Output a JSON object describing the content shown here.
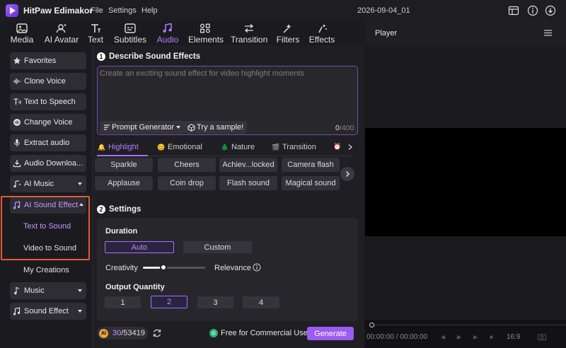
{
  "app": {
    "name": "HitPaw Edimakor",
    "menus": [
      "File",
      "Settings",
      "Help"
    ],
    "project": "2026-09-04_01"
  },
  "tabs": [
    {
      "label": "Media",
      "icon": "media-icon"
    },
    {
      "label": "AI Avatar",
      "icon": "ai-avatar-icon"
    },
    {
      "label": "Text",
      "icon": "text-icon"
    },
    {
      "label": "Subtitles",
      "icon": "subtitles-icon"
    },
    {
      "label": "Audio",
      "icon": "audio-icon",
      "active": true
    },
    {
      "label": "Elements",
      "icon": "elements-icon"
    },
    {
      "label": "Transition",
      "icon": "transition-icon"
    },
    {
      "label": "Filters",
      "icon": "filters-icon"
    },
    {
      "label": "Effects",
      "icon": "effects-icon"
    }
  ],
  "sidebar": {
    "items": [
      {
        "label": "Favorites",
        "icon": "star-icon"
      },
      {
        "label": "Clone Voice",
        "icon": "wave-icon"
      },
      {
        "label": "Text to Speech",
        "icon": "tts-icon"
      },
      {
        "label": "Change Voice",
        "icon": "voice-icon"
      },
      {
        "label": "Extract audio",
        "icon": "mic-icon"
      },
      {
        "label": "Audio Downloa...",
        "icon": "download-icon"
      },
      {
        "label": "AI Music",
        "icon": "ai-music-icon"
      },
      {
        "label": "AI Sound Effect",
        "icon": "ai-sound-icon",
        "active": true
      },
      {
        "label": "Music",
        "icon": "music-icon"
      },
      {
        "label": "Sound Effect",
        "icon": "sound-effect-icon"
      }
    ],
    "sub": [
      "Text to Sound",
      "Video to Sound"
    ],
    "my_creations": "My Creations"
  },
  "describe": {
    "number": "1",
    "title": "Describe Sound Effects",
    "placeholder": "Create an exciting sound effect for video highlight moments",
    "prompt_generator": "Prompt Generator",
    "try_sample": "Try a sample!",
    "count": "0",
    "max": "/400"
  },
  "categories": [
    "Highlight",
    "Emotional",
    "Nature",
    "Transition"
  ],
  "chips": [
    [
      "Sparkle",
      "Cheers",
      "Achiev...locked",
      "Camera flash"
    ],
    [
      "Applause",
      "Coin drop",
      "Flash sound",
      "Magical sound"
    ]
  ],
  "settings": {
    "number": "2",
    "title": "Settings",
    "duration_label": "Duration",
    "auto": "Auto",
    "custom": "Custom",
    "creativity": "Creativity",
    "relevance": "Relevance",
    "creativity_level": 0.28,
    "quantity_label": "Output Quantity",
    "quantities": [
      "1",
      "2",
      "3",
      "4"
    ],
    "selected_quantity": "2"
  },
  "footer": {
    "coin": "AI",
    "used": "30",
    "total": "/53419",
    "free": "Free for Commercial Use",
    "generate": "Generate"
  },
  "player": {
    "title": "Player",
    "timecode": "00:00:00 / 00:00:00",
    "zoom": "16:9"
  },
  "colors": {
    "accent": "#a770ff",
    "generate": "#9b5cf2",
    "highlight_box": "#e05a3a"
  }
}
